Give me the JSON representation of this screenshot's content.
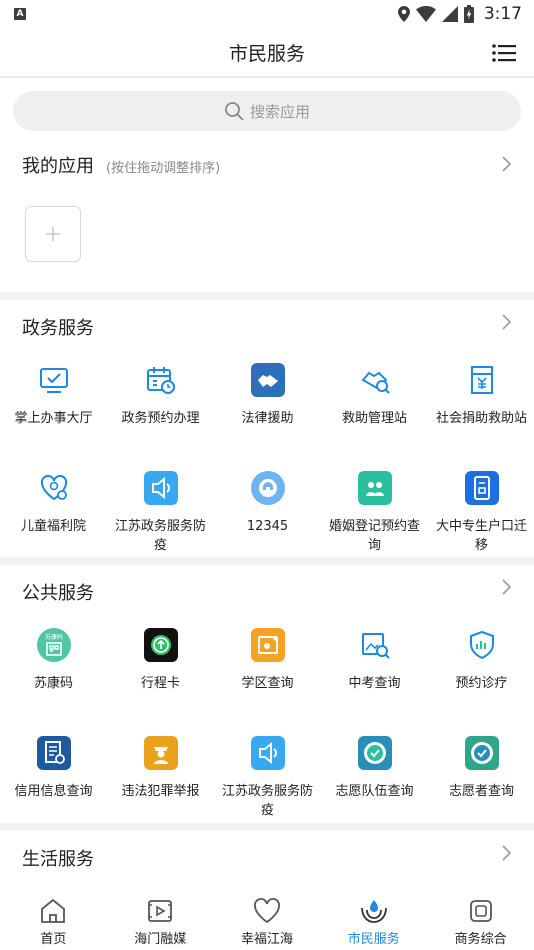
{
  "status_bar": {
    "badge": "A",
    "time": "3:17"
  },
  "header": {
    "title": "市民服务",
    "menu_icon": "list-menu-icon"
  },
  "search": {
    "placeholder": "搜索应用"
  },
  "my_apps": {
    "title": "我的应用",
    "hint": "(按住拖动调整排序)"
  },
  "sections": [
    {
      "title": "政务服务",
      "items": [
        {
          "label": "掌上办事大厅",
          "icon": "monitor-check-icon"
        },
        {
          "label": "政务预约办理",
          "icon": "calendar-clock-icon"
        },
        {
          "label": "法律援助",
          "icon": "handshake-icon"
        },
        {
          "label": "救助管理站",
          "icon": "helping-hands-search-icon"
        },
        {
          "label": "社会捐助救助站",
          "icon": "yen-receipt-icon"
        },
        {
          "label": "儿童福利院",
          "icon": "heart-child-icon"
        },
        {
          "label": "江苏政务服务防疫",
          "icon": "speaker-icon"
        },
        {
          "label": "12345",
          "icon": "hotline-icon"
        },
        {
          "label": "婚姻登记预约查询",
          "icon": "couple-icon"
        },
        {
          "label": "大中专生户口迁移",
          "icon": "id-card-icon"
        }
      ]
    },
    {
      "title": "公共服务",
      "items": [
        {
          "label": "苏康码",
          "icon": "health-code-icon",
          "badge_text": "苏康码"
        },
        {
          "label": "行程卡",
          "icon": "trip-card-icon"
        },
        {
          "label": "学区查询",
          "icon": "school-district-icon"
        },
        {
          "label": "中考查询",
          "icon": "exam-search-icon"
        },
        {
          "label": "预约诊疗",
          "icon": "medical-shield-icon"
        },
        {
          "label": "信用信息查询",
          "icon": "credit-document-icon"
        },
        {
          "label": "违法犯罪举报",
          "icon": "police-report-icon"
        },
        {
          "label": "江苏政务服务防疫",
          "icon": "speaker-icon"
        },
        {
          "label": "志愿队伍查询",
          "icon": "volunteer-team-icon"
        },
        {
          "label": "志愿者查询",
          "icon": "volunteer-icon"
        }
      ]
    },
    {
      "title": "生活服务",
      "items": []
    }
  ],
  "tabbar": {
    "tabs": [
      {
        "label": "首页",
        "icon": "home-icon",
        "active": false
      },
      {
        "label": "海门融媒",
        "icon": "media-play-icon",
        "active": false
      },
      {
        "label": "幸福江海",
        "icon": "heart-icon",
        "active": false
      },
      {
        "label": "市民服务",
        "icon": "citizen-service-icon",
        "active": true
      },
      {
        "label": "商务综合",
        "icon": "business-icon",
        "active": false
      }
    ]
  },
  "colors": {
    "accent": "#1e88e5",
    "section_gap": "#f2f2f2",
    "search_bg": "#efefef"
  }
}
